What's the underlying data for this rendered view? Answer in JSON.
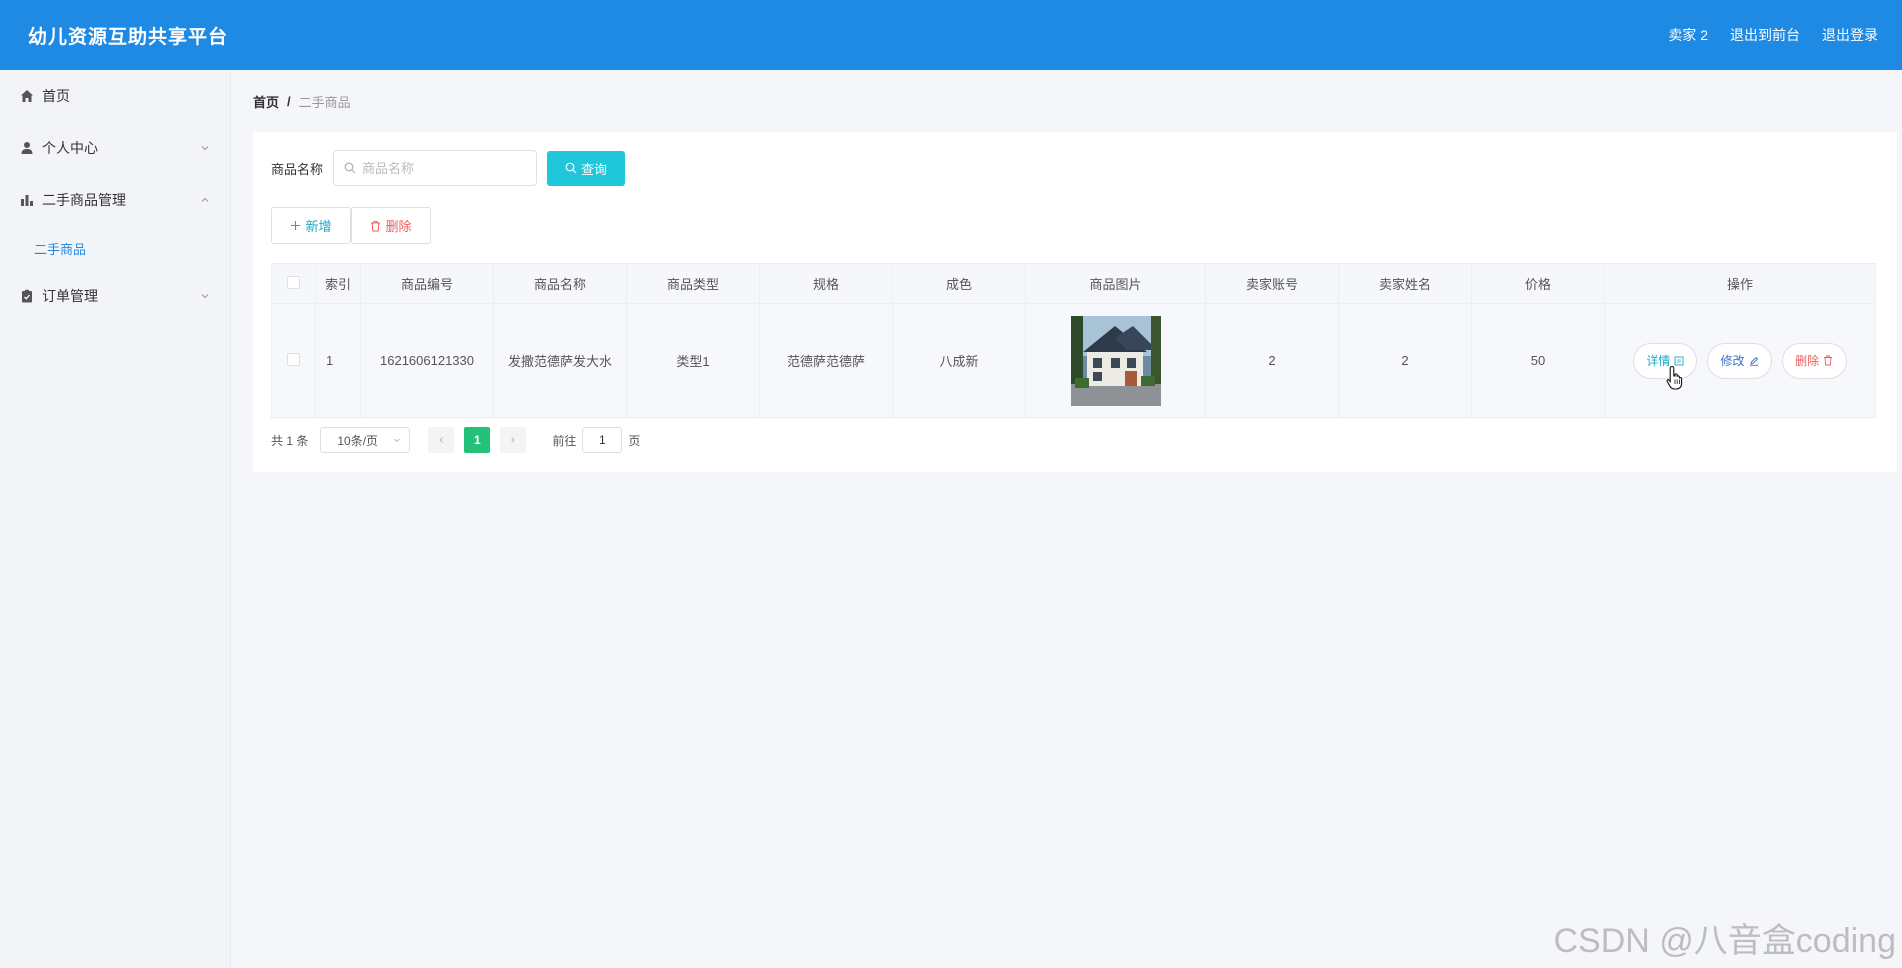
{
  "header": {
    "title": "幼儿资源互助共享平台",
    "user": "卖家 2",
    "to_front": "退出到前台",
    "logout": "退出登录"
  },
  "sidebar": {
    "items": [
      {
        "label": "首页",
        "icon": "home-icon"
      },
      {
        "label": "个人中心",
        "icon": "user-icon",
        "expanded": false
      },
      {
        "label": "二手商品管理",
        "icon": "chart-icon",
        "expanded": true,
        "children": [
          {
            "label": "二手商品"
          }
        ]
      },
      {
        "label": "订单管理",
        "icon": "clipboard-icon",
        "expanded": false
      }
    ]
  },
  "breadcrumb": {
    "home": "首页",
    "separator": "/",
    "current": "二手商品"
  },
  "search": {
    "label": "商品名称",
    "placeholder": "商品名称",
    "value": "",
    "button": "查询"
  },
  "toolbar": {
    "add": "新增",
    "delete": "删除"
  },
  "table": {
    "columns": [
      "索引",
      "商品编号",
      "商品名称",
      "商品类型",
      "规格",
      "成色",
      "商品图片",
      "卖家账号",
      "卖家姓名",
      "价格",
      "操作"
    ],
    "rows": [
      {
        "index": "1",
        "code": "1621606121330",
        "name": "发撒范德萨发大水",
        "type": "类型1",
        "spec": "范德萨范德萨",
        "condition": "八成新",
        "image": "house-thumbnail",
        "seller_account": "2",
        "seller_name": "2",
        "price": "50"
      }
    ],
    "actions": {
      "detail": "详情",
      "edit": "修改",
      "delete": "删除"
    }
  },
  "pagination": {
    "total": "共 1 条",
    "page_size": "10条/页",
    "current_page": "1",
    "goto_label": "前往",
    "goto_value": "1",
    "page_unit": "页"
  },
  "watermark": "CSDN @八音盒coding",
  "colors": {
    "header": "#1f8ae4",
    "accent_cyan": "#20c6d9",
    "danger": "#f15b5b",
    "page_active": "#24c17a"
  }
}
